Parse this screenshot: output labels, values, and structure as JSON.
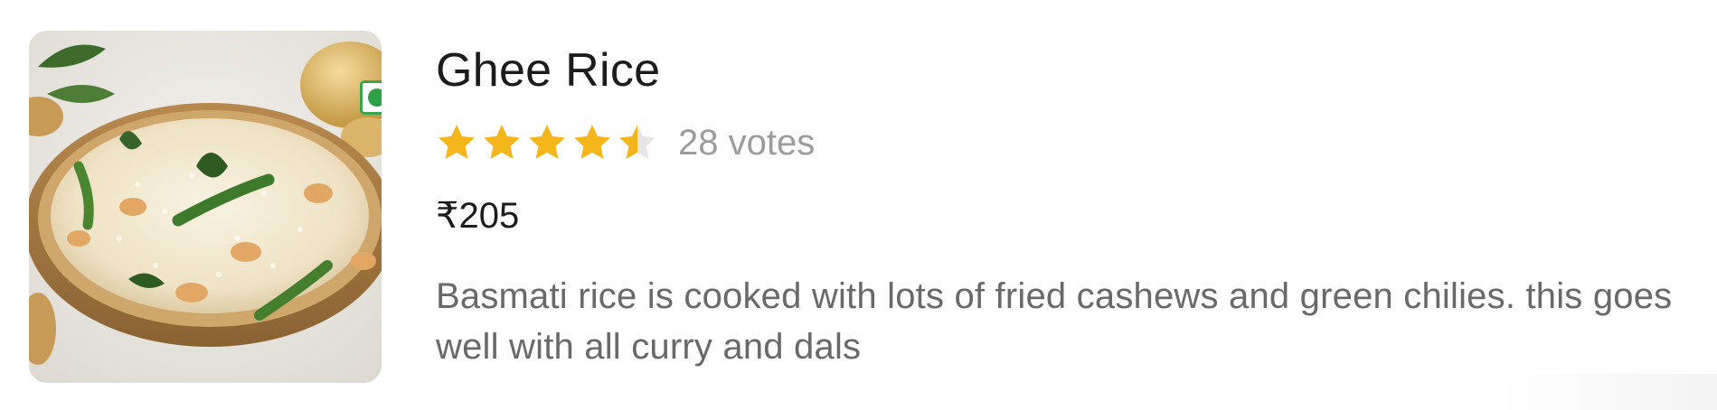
{
  "dish": {
    "name": "Ghee Rice",
    "rating": 4.5,
    "rating_max": 5,
    "votes_label": "28 votes",
    "price": "₹205",
    "description": "Basmati rice is cooked with lots of fried cashews and green chilies. this goes well with all curry and dals",
    "diet_type_icon": "veg-indicator-icon",
    "image_icon": "ghee-rice-photo"
  },
  "colors": {
    "star_filled": "#f4b61b",
    "star_empty": "#e6e6e6",
    "veg_green": "#2ea148",
    "title": "#1c1c1c",
    "muted": "#9c9c9c",
    "description": "#696969"
  }
}
